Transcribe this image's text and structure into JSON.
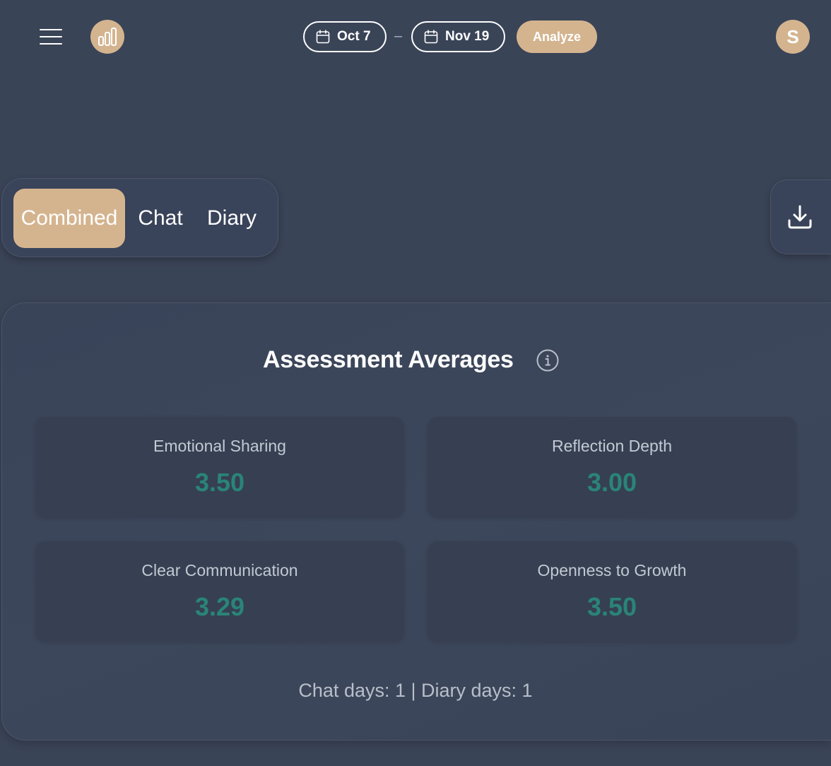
{
  "header": {
    "menu_icon": "hamburger-menu-icon",
    "logo_icon": "bar-chart-icon",
    "date_start": "Oct 7",
    "date_separator": "–",
    "date_end": "Nov 19",
    "analyze_label": "Analyze",
    "avatar_initial": "S",
    "accent_color": "#d4b48f"
  },
  "tabs": [
    {
      "label": "Combined",
      "active": true
    },
    {
      "label": "Chat",
      "active": false
    },
    {
      "label": "Diary",
      "active": false
    }
  ],
  "download_icon": "download-icon",
  "assessment": {
    "title": "Assessment Averages",
    "info_icon": "info-icon",
    "metrics": [
      {
        "label": "Emotional Sharing",
        "value": "3.50"
      },
      {
        "label": "Reflection Depth",
        "value": "3.00"
      },
      {
        "label": "Clear Communication",
        "value": "3.29"
      },
      {
        "label": "Openness to Growth",
        "value": "3.50"
      }
    ],
    "value_color": "#2a8478",
    "counts": "Chat days: 1 | Diary days: 1"
  }
}
